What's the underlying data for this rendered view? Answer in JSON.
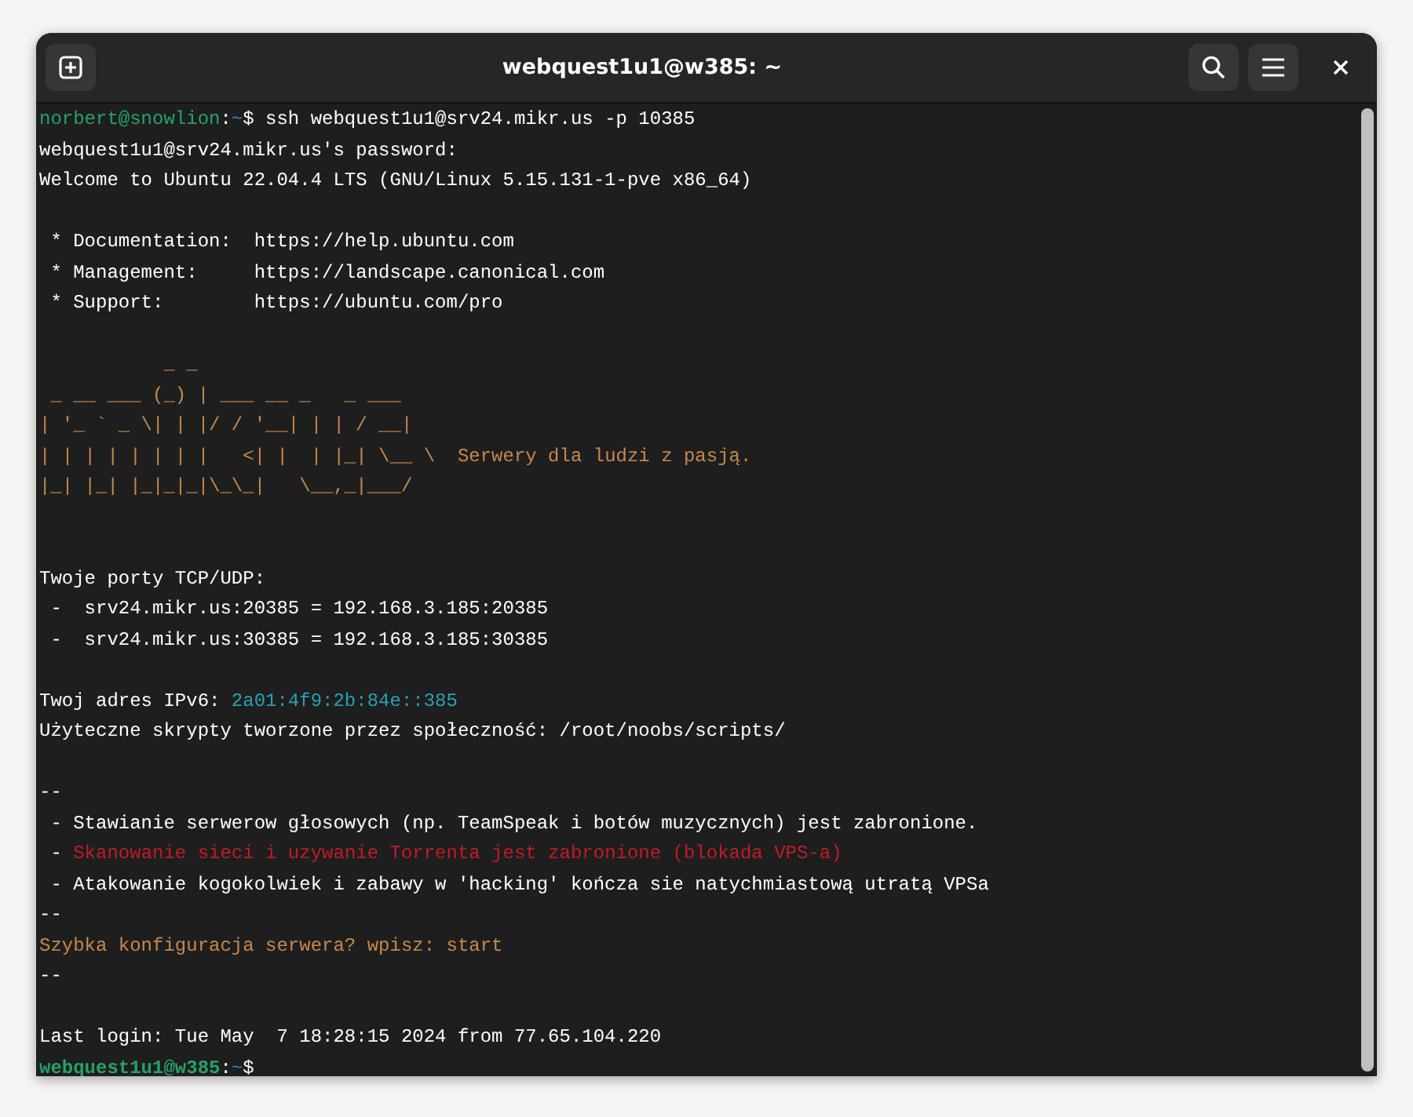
{
  "window": {
    "title": "webquest1u1@w385: ~"
  },
  "terminal": {
    "lines": [
      {
        "kind": "text",
        "segments": [
          {
            "text": "norbert@snowlion",
            "kind": "user"
          },
          {
            "text": ":",
            "kind": "plain"
          },
          {
            "text": "~",
            "kind": "path"
          },
          {
            "text": "$ ssh webquest1u1@srv24.mikr.us -p 10385",
            "kind": "plain"
          }
        ]
      },
      {
        "kind": "text",
        "segments": [
          {
            "text": "webquest1u1@srv24.mikr.us's password:",
            "kind": "plain"
          }
        ]
      },
      {
        "kind": "text",
        "segments": [
          {
            "text": "Welcome to Ubuntu 22.04.4 LTS (GNU/Linux 5.15.131-1-pve x86_64)",
            "kind": "plain"
          }
        ]
      },
      {
        "kind": "blank"
      },
      {
        "kind": "text",
        "segments": [
          {
            "text": " * Documentation:  https://help.ubuntu.com",
            "kind": "plain"
          }
        ]
      },
      {
        "kind": "text",
        "segments": [
          {
            "text": " * Management:     https://landscape.canonical.com",
            "kind": "plain"
          }
        ]
      },
      {
        "kind": "text",
        "segments": [
          {
            "text": " * Support:        https://ubuntu.com/pro",
            "kind": "plain"
          }
        ]
      },
      {
        "kind": "blank"
      },
      {
        "kind": "text",
        "segments": [
          {
            "text": "           _ _",
            "kind": "accent"
          }
        ]
      },
      {
        "kind": "text",
        "segments": [
          {
            "text": " _ __ ___ (_) | ___ __ _   _ ___",
            "kind": "accent"
          }
        ]
      },
      {
        "kind": "text",
        "segments": [
          {
            "text": "| '_ ` _ \\| | |/ / '__| | | / __|",
            "kind": "accent"
          }
        ]
      },
      {
        "kind": "text",
        "segments": [
          {
            "text": "| | | | | | | |   <| |  | |_| \\__ \\",
            "kind": "accent"
          },
          {
            "text": "  Serwery dla ludzi z pasją.",
            "kind": "accent"
          }
        ]
      },
      {
        "kind": "text",
        "segments": [
          {
            "text": "|_| |_| |_|_|_|\\_\\_|   \\__,_|___/",
            "kind": "accent"
          }
        ]
      },
      {
        "kind": "blank"
      },
      {
        "kind": "blank"
      },
      {
        "kind": "text",
        "segments": [
          {
            "text": "Twoje porty TCP/UDP:",
            "kind": "plain"
          }
        ]
      },
      {
        "kind": "text",
        "segments": [
          {
            "text": " -  srv24.mikr.us:20385 = 192.168.3.185:20385",
            "kind": "plain"
          }
        ]
      },
      {
        "kind": "text",
        "segments": [
          {
            "text": " -  srv24.mikr.us:30385 = 192.168.3.185:30385",
            "kind": "plain"
          }
        ]
      },
      {
        "kind": "blank"
      },
      {
        "kind": "text",
        "segments": [
          {
            "text": "Twoj adres IPv6: ",
            "kind": "plain"
          },
          {
            "text": "2a01:4f9:2b:84e::385",
            "kind": "address"
          }
        ]
      },
      {
        "kind": "text",
        "segments": [
          {
            "text": "Użyteczne skrypty tworzone przez społeczność: /root/noobs/scripts/",
            "kind": "plain"
          }
        ]
      },
      {
        "kind": "blank"
      },
      {
        "kind": "text",
        "segments": [
          {
            "text": "--",
            "kind": "plain"
          }
        ]
      },
      {
        "kind": "text",
        "segments": [
          {
            "text": " - Stawianie serwerow głosowych (np. TeamSpeak i botów muzycznych) jest zabronione.",
            "kind": "plain"
          }
        ]
      },
      {
        "kind": "text",
        "segments": [
          {
            "text": " - ",
            "kind": "plain"
          },
          {
            "text": "Skanowanie sieci i uzywanie Torrenta jest zabronione (blokada VPS-a)",
            "kind": "warning"
          }
        ]
      },
      {
        "kind": "text",
        "segments": [
          {
            "text": " - Atakowanie kogokolwiek i zabawy w 'hacking' kończa sie natychmiastową utratą VPSa",
            "kind": "plain"
          }
        ]
      },
      {
        "kind": "text",
        "segments": [
          {
            "text": "--",
            "kind": "plain"
          }
        ]
      },
      {
        "kind": "text",
        "segments": [
          {
            "text": "Szybka konfiguracja serwera? wpisz: start",
            "kind": "accent"
          }
        ]
      },
      {
        "kind": "text",
        "segments": [
          {
            "text": "--",
            "kind": "plain"
          }
        ]
      },
      {
        "kind": "blank"
      },
      {
        "kind": "text",
        "segments": [
          {
            "text": "Last login: Tue May  7 18:28:15 2024 from 77.65.104.220",
            "kind": "plain"
          }
        ]
      },
      {
        "kind": "text",
        "segments": [
          {
            "text": "webquest1u1@w385",
            "kind": "prompt"
          },
          {
            "text": ":",
            "kind": "plain"
          },
          {
            "text": "~",
            "kind": "path"
          },
          {
            "text": "$",
            "kind": "plain"
          }
        ]
      }
    ]
  }
}
